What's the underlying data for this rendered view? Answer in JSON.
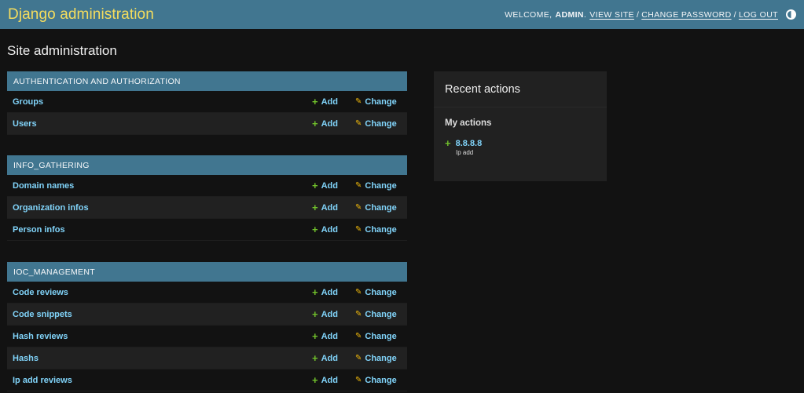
{
  "header": {
    "brand": "Django administration",
    "welcome": "WELCOME,",
    "username": "ADMIN",
    "view_site": "VIEW SITE",
    "change_password": "CHANGE PASSWORD",
    "log_out": "LOG OUT",
    "separator": "/",
    "dot": "."
  },
  "page_title": "Site administration",
  "modules": [
    {
      "caption": "AUTHENTICATION AND AUTHORIZATION",
      "rows": [
        "Groups",
        "Users"
      ]
    },
    {
      "caption": "INFO_GATHERING",
      "rows": [
        "Domain names",
        "Organization infos",
        "Person infos"
      ]
    },
    {
      "caption": "IOC_MANAGEMENT",
      "rows": [
        "Code reviews",
        "Code snippets",
        "Hash reviews",
        "Hashs",
        "Ip add reviews"
      ]
    }
  ],
  "actions": {
    "add_label": "Add",
    "change_label": "Change",
    "add_icon": "plus-icon",
    "change_icon": "pencil-icon"
  },
  "recent_actions": {
    "title": "Recent actions",
    "subtitle": "My actions",
    "items": [
      {
        "label": "8.8.8.8",
        "type": "Ip add"
      }
    ]
  },
  "colors": {
    "header_bg": "#417690",
    "brand": "#f5dd5d",
    "link": "#81d4fa",
    "add": "#70bf2b",
    "change": "#efb80b",
    "background": "#121212"
  }
}
